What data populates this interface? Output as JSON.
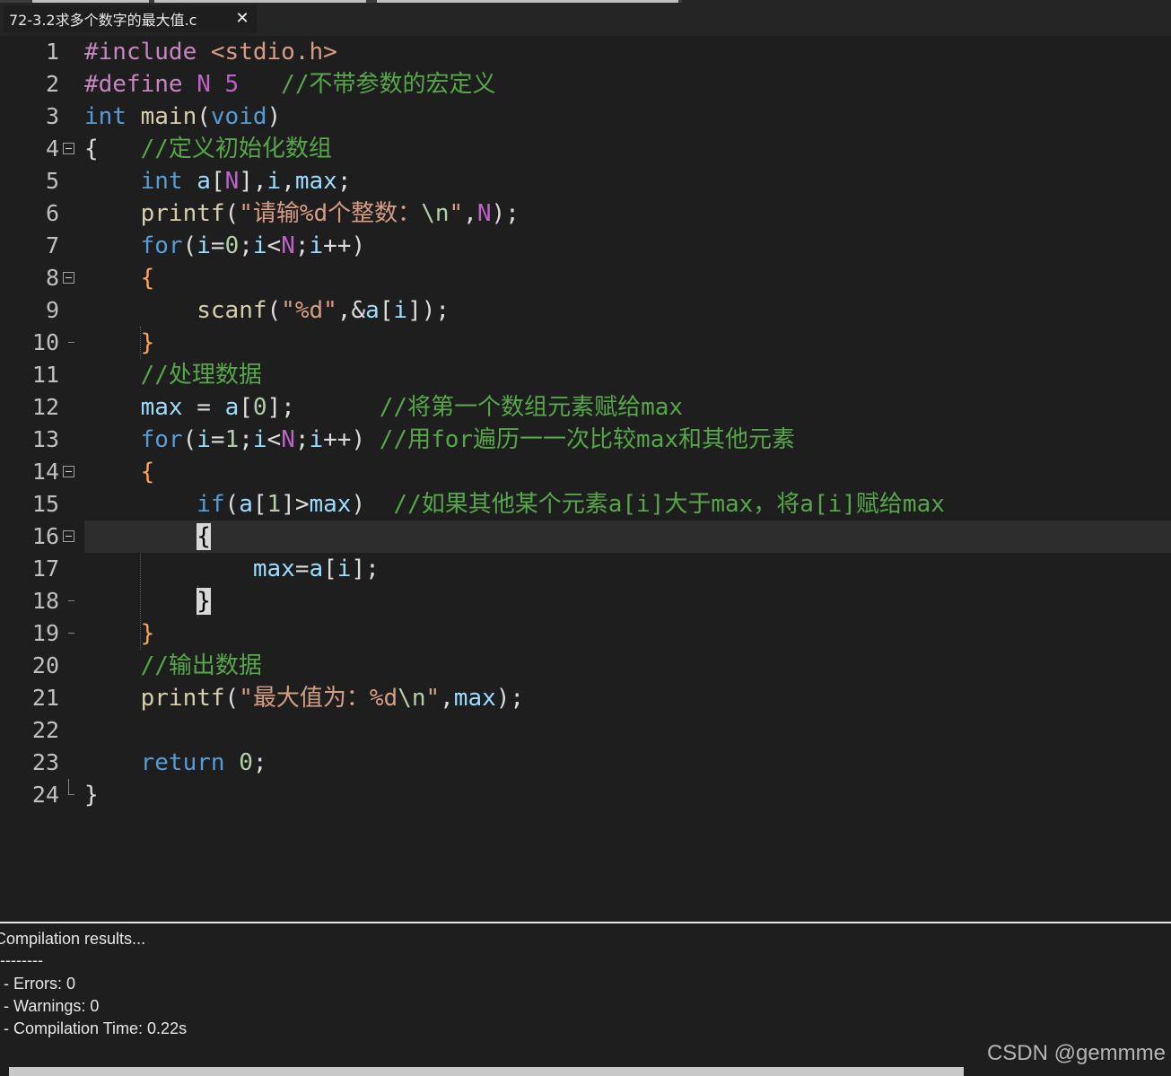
{
  "tab": {
    "title": "72-3.2求多个数字的最大值.c",
    "close_glyph": "✕"
  },
  "editor": {
    "current_line": 16,
    "lines": [
      {
        "n": "1"
      },
      {
        "n": "2"
      },
      {
        "n": "3"
      },
      {
        "n": "4"
      },
      {
        "n": "5"
      },
      {
        "n": "6"
      },
      {
        "n": "7"
      },
      {
        "n": "8"
      },
      {
        "n": "9"
      },
      {
        "n": "10"
      },
      {
        "n": "11"
      },
      {
        "n": "12"
      },
      {
        "n": "13"
      },
      {
        "n": "14"
      },
      {
        "n": "15"
      },
      {
        "n": "16"
      },
      {
        "n": "17"
      },
      {
        "n": "18"
      },
      {
        "n": "19"
      },
      {
        "n": "20"
      },
      {
        "n": "21"
      },
      {
        "n": "22"
      },
      {
        "n": "23"
      },
      {
        "n": "24"
      }
    ],
    "code": {
      "l1": {
        "a": "#include",
        "b": " <stdio.h>"
      },
      "l2": {
        "a": "#define",
        "b": " N",
        "c": " 5",
        "d": "   //不带参数的宏定义"
      },
      "l3": {
        "a": "int",
        "b": " main",
        "c": "(",
        "d": "void",
        "e": ")"
      },
      "l4": {
        "a": "{",
        "b": "   //定义初始化数组"
      },
      "l5": {
        "a": "    ",
        "b": "int",
        "c": " a",
        "d": "[",
        "e": "N",
        "f": "]",
        "g": ",",
        "h": "i",
        "i": ",",
        "j": "max",
        "k": ";"
      },
      "l6": {
        "a": "    ",
        "b": "printf",
        "c": "(",
        "d": "\"请输",
        "e": "%d",
        "f": "个整数：",
        "g": "\\n",
        "h": "\"",
        "i": ",",
        "j": "N",
        "k": ");"
      },
      "l7": {
        "a": "    ",
        "b": "for",
        "c": "(",
        "d": "i",
        "e": "=",
        "f": "0",
        "g": ";",
        "h": "i",
        "i": "<",
        "j": "N",
        "k": ";",
        "l": "i",
        "m": "++",
        "o": ")"
      },
      "l8": {
        "a": "    ",
        "b": "{"
      },
      "l9": {
        "a": "        ",
        "b": "scanf",
        "c": "(",
        "d": "\"%d\"",
        "e": ",&",
        "f": "a",
        "g": "[",
        "h": "i",
        "i": "]);"
      },
      "l10": {
        "a": "    ",
        "b": "}"
      },
      "l11": {
        "a": "    ",
        "b": "//处理数据"
      },
      "l12": {
        "a": "    ",
        "b": "max",
        "c": " = ",
        "d": "a",
        "e": "[",
        "f": "0",
        "g": "];",
        "h": "      //将第一个数组元素赋给max"
      },
      "l13": {
        "a": "    ",
        "b": "for",
        "c": "(",
        "d": "i",
        "e": "=",
        "f": "1",
        "g": ";",
        "h": "i",
        "i": "<",
        "j": "N",
        "k": ";",
        "l": "i",
        "m": "++",
        "o": ")",
        "p": " //用for遍历一一次比较max和其他元素"
      },
      "l14": {
        "a": "    ",
        "b": "{"
      },
      "l15": {
        "a": "        ",
        "b": "if",
        "c": "(",
        "d": "a",
        "e": "[",
        "f": "1",
        "g": "]>",
        "h": "max",
        "i": ")",
        "j": "  //如果其他某个元素a[i]大于max，将a[i]赋给max"
      },
      "l16": {
        "a": "        ",
        "b": "{"
      },
      "l17": {
        "a": "            ",
        "b": "max",
        "c": "=",
        "d": "a",
        "e": "[",
        "f": "i",
        "g": "];"
      },
      "l18": {
        "a": "        ",
        "b": "}"
      },
      "l19": {
        "a": "    ",
        "b": "}"
      },
      "l20": {
        "a": "    ",
        "b": "//输出数据"
      },
      "l21": {
        "a": "    ",
        "b": "printf",
        "c": "(",
        "d": "\"最大值为：",
        "e": "%d",
        "f": "\\n",
        "g": "\"",
        "h": ",",
        "i": "max",
        "j": ");"
      },
      "l22": {},
      "l23": {
        "a": "    ",
        "b": "return",
        "c": " ",
        "d": "0",
        "e": ";"
      },
      "l24": {
        "a": "}"
      }
    }
  },
  "output": {
    "lines": [
      "Compilation results...",
      "--------",
      "- Errors: 0",
      "- Warnings: 0",
      "- Compilation Time: 0.22s"
    ]
  },
  "watermark": "CSDN @gemmme",
  "colors": {
    "background": "#1e1e1e",
    "keyword": "#569cd6",
    "preprocessor": "#c586c0",
    "comment": "#57a64a",
    "string": "#d69d85",
    "variable": "#9cdcfe",
    "number": "#b5cea8",
    "function": "#d7ceac",
    "current_line_highlight": "#2d2d2d"
  }
}
